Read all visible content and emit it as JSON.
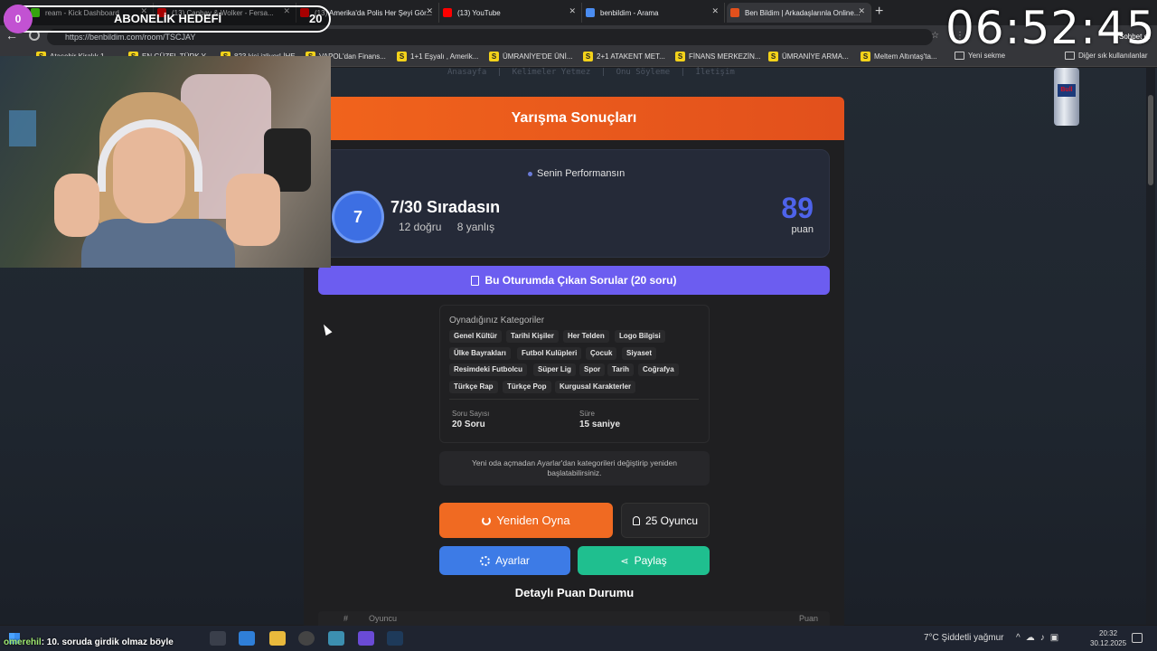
{
  "tabs": [
    {
      "label": "ream - Kick Dashboard",
      "color": "#53fc18"
    },
    {
      "label": "(13) Canbay & Wolker - Fersa...",
      "color": "#ff0000"
    },
    {
      "label": "(13) Amerika'da Polis Her Şeyi Gör...",
      "color": "#ff0000"
    },
    {
      "label": "(13) YouTube",
      "color": "#ff0000"
    },
    {
      "label": "benbildim - Arama",
      "color": "#4a8cf0"
    },
    {
      "label": "Ben Bildim | Arkadaşlarınla Online...",
      "color": "#e2501c"
    }
  ],
  "url": "https://benbildim.com/room/TSCJAY",
  "bookmarks": [
    {
      "label": "Ataşehir Kiralık 1...",
      "icon": "s"
    },
    {
      "label": "EN GÜZEL TÜRK Y...",
      "icon": "s"
    },
    {
      "label": "823 kişi izliyor! İHE...",
      "icon": "s"
    },
    {
      "label": "VAPOL'dan Finans...",
      "icon": "s"
    },
    {
      "label": "1+1 Eşyalı , Amerik...",
      "icon": "s"
    },
    {
      "label": "ÜMRANİYE'DE ÜNİ...",
      "icon": "s"
    },
    {
      "label": "2+1 ATAKENT MET...",
      "icon": "s"
    },
    {
      "label": "FİNANS MERKEZİN...",
      "icon": "s"
    },
    {
      "label": "ÜMRANİYE ARMA...",
      "icon": "s"
    },
    {
      "label": "Meltem Altıntaş'ta...",
      "icon": "s"
    },
    {
      "label": "Yeni sekme",
      "icon": "folder"
    },
    {
      "label": "Diğer sık kullanılanlar",
      "icon": "folder"
    }
  ],
  "site_nav": [
    "Anasayfa",
    "|",
    "Kelimeler Yetmez",
    "|",
    "Onu Söyleme",
    "|",
    "İletişim"
  ],
  "results": {
    "header": "Yarışma Sonuçları",
    "perf_label": "Senin Performansın",
    "rank": "7",
    "rank_text": "7/30 Sıradasın",
    "correct": "12 doğru",
    "wrong": "8 yanlış",
    "score": "89",
    "score_unit": "puan",
    "questions_button": "Bu Oturumda Çıkan Sorular (20 soru)",
    "categories_title": "Oynadığınız Kategoriler",
    "categories": [
      "Genel Kültür",
      "Tarihi Kişiler",
      "Her Telden",
      "Logo Bilgisi",
      "Ülke Bayrakları",
      "Futbol Kulüpleri",
      "Çocuk",
      "Siyaset",
      "Resimdeki Futbolcu",
      "Süper Lig",
      "Spor",
      "Tarih",
      "Coğrafya",
      "Türkçe Rap",
      "Türkçe Pop",
      "Kurgusal Karakterler"
    ],
    "question_count_label": "Soru Sayısı",
    "question_count": "20 Soru",
    "duration_label": "Süre",
    "duration": "15 saniye",
    "note": "Yeni oda açmadan Ayarlar'dan kategorileri değiştirip yeniden başlatabilirsiniz.",
    "replay_button": "Yeniden Oyna",
    "players_button": "25 Oyuncu",
    "settings_button": "Ayarlar",
    "share_button": "Paylaş",
    "detail_title": "Detaylı Puan Durumu",
    "table_headers": [
      "#",
      "Oyuncu",
      "Puan"
    ]
  },
  "overlay": {
    "goal_current": "0",
    "goal_title": "ABONELİK HEDEFİ",
    "goal_target": "20",
    "clock": "06:52:45",
    "sohbet": "Sohbet et",
    "can_label": "Bull"
  },
  "taskbar": {
    "chat_user": "omerehil",
    "chat_text": ": 10. soruda girdik olmaz böyle",
    "weather": "7°C  Şiddetli yağmur",
    "time": "20:32",
    "date": "30.12.2025"
  }
}
